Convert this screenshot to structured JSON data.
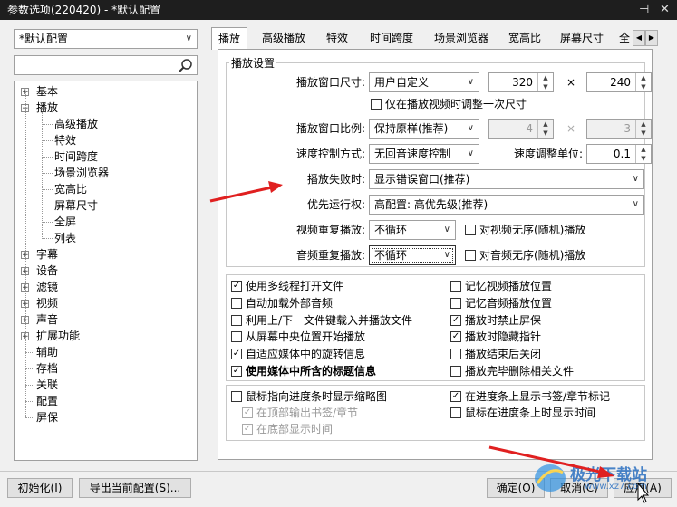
{
  "window": {
    "title": "参数选项(220420) - *默认配置",
    "pin_glyph": "⊣",
    "close_glyph": "✕"
  },
  "left": {
    "profile_select": "*默认配置",
    "search_value": "",
    "tree": [
      {
        "label": "基本",
        "level": 0,
        "expander": "+"
      },
      {
        "label": "播放",
        "level": 0,
        "expander": "−"
      },
      {
        "label": "高级播放",
        "level": 1
      },
      {
        "label": "特效",
        "level": 1
      },
      {
        "label": "时间跨度",
        "level": 1
      },
      {
        "label": "场景浏览器",
        "level": 1
      },
      {
        "label": "宽高比",
        "level": 1
      },
      {
        "label": "屏幕尺寸",
        "level": 1
      },
      {
        "label": "全屏",
        "level": 1
      },
      {
        "label": "列表",
        "level": 1
      },
      {
        "label": "字幕",
        "level": 0,
        "expander": "+"
      },
      {
        "label": "设备",
        "level": 0,
        "expander": "+"
      },
      {
        "label": "滤镜",
        "level": 0,
        "expander": "+"
      },
      {
        "label": "视频",
        "level": 0,
        "expander": "+"
      },
      {
        "label": "声音",
        "level": 0,
        "expander": "+"
      },
      {
        "label": "扩展功能",
        "level": 0,
        "expander": "+"
      },
      {
        "label": "辅助",
        "level": 0
      },
      {
        "label": "存档",
        "level": 0
      },
      {
        "label": "关联",
        "level": 0
      },
      {
        "label": "配置",
        "level": 0
      },
      {
        "label": "屏保",
        "level": 0
      }
    ]
  },
  "tabs": [
    "播放",
    "高级播放",
    "特效",
    "时间跨度",
    "场景浏览器",
    "宽高比",
    "屏幕尺寸",
    "全"
  ],
  "tab_scroll": {
    "left": "◀",
    "right": "▶"
  },
  "group_title": "播放设置",
  "form": {
    "window_size_label": "播放窗口尺寸:",
    "window_size_value": "用户自定义",
    "width": "320",
    "height": "240",
    "times": "×",
    "adjust_once_label": "仅在播放视频时调整一次尺寸",
    "ratio_label": "播放窗口比例:",
    "ratio_value": "保持原样(推荐)",
    "ratio_w": "4",
    "ratio_h": "3",
    "speed_mode_label": "速度控制方式:",
    "speed_mode_value": "无回音速度控制",
    "speed_unit_label": "速度调整单位:",
    "speed_unit_value": "0.1",
    "fail_label": "播放失败时:",
    "fail_value": "显示错误窗口(推荐)",
    "priority_label": "优先运行权:",
    "priority_value": "高配置: 高优先级(推荐)",
    "video_repeat_label": "视频重复播放:",
    "video_repeat_value": "不循环",
    "video_shuffle_label": "对视频无序(随机)播放",
    "audio_repeat_label": "音频重复播放:",
    "audio_repeat_value": "不循环",
    "audio_shuffle_label": "对音频无序(随机)播放"
  },
  "options_left": [
    {
      "label": "使用多线程打开文件",
      "checked": true
    },
    {
      "label": "自动加载外部音频",
      "checked": false
    },
    {
      "label": "利用上/下一文件键载入并播放文件",
      "checked": false
    },
    {
      "label": "从屏幕中央位置开始播放",
      "checked": false
    },
    {
      "label": "自适应媒体中的旋转信息",
      "checked": true
    },
    {
      "label": "使用媒体中所含的标题信息",
      "checked": true
    }
  ],
  "options_right": [
    {
      "label": "记忆视频播放位置",
      "checked": false
    },
    {
      "label": "记忆音频播放位置",
      "checked": false
    },
    {
      "label": "播放时禁止屏保",
      "checked": true
    },
    {
      "label": "播放时隐藏指针",
      "checked": true
    },
    {
      "label": "播放结束后关闭",
      "checked": false
    },
    {
      "label": "播放完毕删除相关文件",
      "checked": false
    }
  ],
  "seek_options": {
    "thumbnail": {
      "label": "鼠标指向进度条时显示缩略图",
      "checked": false
    },
    "top_bookmark": {
      "label": "在顶部输出书签/章节",
      "checked": true
    },
    "bottom_time": {
      "label": "在底部显示时间",
      "checked": true
    },
    "show_bookmarks": {
      "label": "在进度条上显示书签/章节标记",
      "checked": true
    },
    "hover_time": {
      "label": "鼠标在进度条上时显示时间",
      "checked": false
    }
  },
  "buttons": {
    "init": "初始化(I)",
    "export": "导出当前配置(S)...",
    "ok": "确定(O)",
    "cancel": "取消(C)",
    "apply": "应用(A)"
  },
  "watermark": {
    "text": "极光下载站",
    "url": "www.xz7.com"
  },
  "colors": {
    "annotation_arrow": "#e02020",
    "titlebar": "#1e1e1e"
  }
}
